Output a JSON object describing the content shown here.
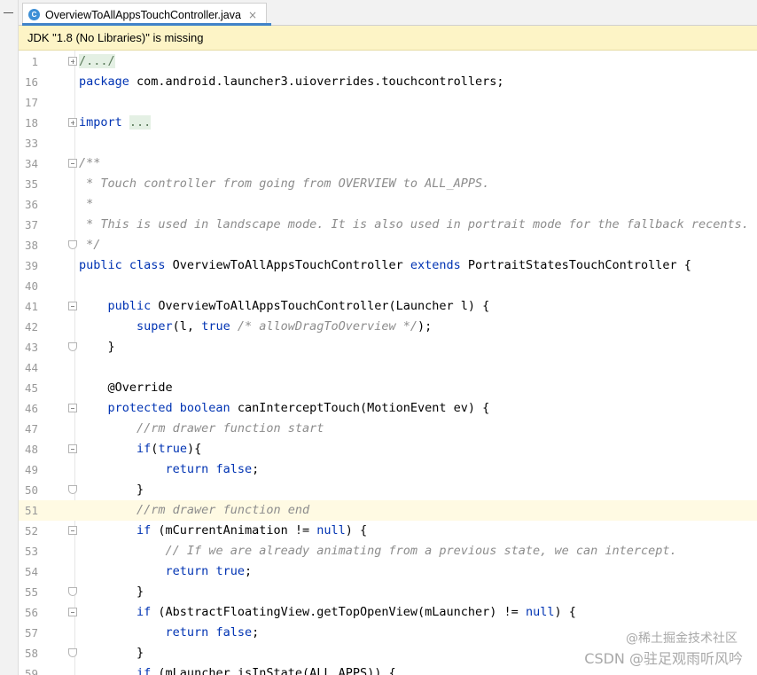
{
  "tab": {
    "icon_letter": "C",
    "file_name": "OverviewToAllAppsTouchController.java",
    "close_symbol": "×"
  },
  "notice": {
    "text": "JDK \"1.8 (No Libraries)\" is missing"
  },
  "editor": {
    "current_line": "51",
    "lines": [
      {
        "n": "1",
        "fold": "plus",
        "tokens": [
          {
            "t": "/.../",
            "c": "fold-text"
          }
        ]
      },
      {
        "n": "16",
        "fold": "",
        "tokens": [
          {
            "t": "package",
            "c": "kw"
          },
          {
            "t": " com.android.launcher3.uioverrides.touchcontrollers;",
            "c": ""
          }
        ]
      },
      {
        "n": "17",
        "fold": "",
        "tokens": []
      },
      {
        "n": "18",
        "fold": "plus",
        "tokens": [
          {
            "t": "import",
            "c": "kw"
          },
          {
            "t": " ",
            "c": ""
          },
          {
            "t": "...",
            "c": "fold-text"
          }
        ]
      },
      {
        "n": "33",
        "fold": "",
        "tokens": []
      },
      {
        "n": "34",
        "fold": "minus",
        "tokens": [
          {
            "t": "/**",
            "c": "cm"
          }
        ]
      },
      {
        "n": "35",
        "fold": "",
        "tokens": [
          {
            "t": " * Touch controller from going from OVERVIEW to ALL_APPS.",
            "c": "cm"
          }
        ]
      },
      {
        "n": "36",
        "fold": "",
        "tokens": [
          {
            "t": " *",
            "c": "cm"
          }
        ]
      },
      {
        "n": "37",
        "fold": "",
        "tokens": [
          {
            "t": " * This is used in landscape mode. It is also used in portrait mode for the fallback recents.",
            "c": "cm"
          }
        ]
      },
      {
        "n": "38",
        "fold": "end",
        "tokens": [
          {
            "t": " */",
            "c": "cm"
          }
        ]
      },
      {
        "n": "39",
        "fold": "",
        "tokens": [
          {
            "t": "public class",
            "c": "kw"
          },
          {
            "t": " OverviewToAllAppsTouchController ",
            "c": ""
          },
          {
            "t": "extends",
            "c": "kw"
          },
          {
            "t": " PortraitStatesTouchController {",
            "c": ""
          }
        ]
      },
      {
        "n": "40",
        "fold": "",
        "tokens": []
      },
      {
        "n": "41",
        "fold": "minus",
        "tokens": [
          {
            "t": "    ",
            "c": ""
          },
          {
            "t": "public",
            "c": "kw"
          },
          {
            "t": " OverviewToAllAppsTouchController(Launcher l) {",
            "c": ""
          }
        ]
      },
      {
        "n": "42",
        "fold": "",
        "tokens": [
          {
            "t": "        ",
            "c": ""
          },
          {
            "t": "super",
            "c": "kw"
          },
          {
            "t": "(l, ",
            "c": ""
          },
          {
            "t": "true",
            "c": "kw"
          },
          {
            "t": " ",
            "c": ""
          },
          {
            "t": "/* allowDragToOverview */",
            "c": "cm"
          },
          {
            "t": ");",
            "c": ""
          }
        ]
      },
      {
        "n": "43",
        "fold": "end",
        "tokens": [
          {
            "t": "    }",
            "c": ""
          }
        ]
      },
      {
        "n": "44",
        "fold": "",
        "tokens": []
      },
      {
        "n": "45",
        "fold": "",
        "tokens": [
          {
            "t": "    @Override",
            "c": "an"
          }
        ]
      },
      {
        "n": "46",
        "fold": "minus",
        "tokens": [
          {
            "t": "    ",
            "c": ""
          },
          {
            "t": "protected boolean",
            "c": "kw"
          },
          {
            "t": " canInterceptTouch(MotionEvent ev) {",
            "c": ""
          }
        ]
      },
      {
        "n": "47",
        "fold": "",
        "tokens": [
          {
            "t": "        ",
            "c": ""
          },
          {
            "t": "//rm drawer function start",
            "c": "cm"
          }
        ]
      },
      {
        "n": "48",
        "fold": "minus",
        "tokens": [
          {
            "t": "        ",
            "c": ""
          },
          {
            "t": "if",
            "c": "kw"
          },
          {
            "t": "(",
            "c": ""
          },
          {
            "t": "true",
            "c": "kw"
          },
          {
            "t": "){",
            "c": ""
          }
        ]
      },
      {
        "n": "49",
        "fold": "",
        "tokens": [
          {
            "t": "            ",
            "c": ""
          },
          {
            "t": "return false",
            "c": "kw"
          },
          {
            "t": ";",
            "c": ""
          }
        ]
      },
      {
        "n": "50",
        "fold": "end",
        "tokens": [
          {
            "t": "        }",
            "c": ""
          }
        ]
      },
      {
        "n": "51",
        "fold": "",
        "tokens": [
          {
            "t": "        ",
            "c": ""
          },
          {
            "t": "//rm drawer function end",
            "c": "cm"
          }
        ]
      },
      {
        "n": "52",
        "fold": "minus",
        "tokens": [
          {
            "t": "        ",
            "c": ""
          },
          {
            "t": "if",
            "c": "kw"
          },
          {
            "t": " (mCurrentAnimation != ",
            "c": ""
          },
          {
            "t": "null",
            "c": "kw"
          },
          {
            "t": ") {",
            "c": ""
          }
        ]
      },
      {
        "n": "53",
        "fold": "",
        "tokens": [
          {
            "t": "            ",
            "c": ""
          },
          {
            "t": "// If we are already animating from a previous state, we can intercept.",
            "c": "cm"
          }
        ]
      },
      {
        "n": "54",
        "fold": "",
        "tokens": [
          {
            "t": "            ",
            "c": ""
          },
          {
            "t": "return true",
            "c": "kw"
          },
          {
            "t": ";",
            "c": ""
          }
        ]
      },
      {
        "n": "55",
        "fold": "end",
        "tokens": [
          {
            "t": "        }",
            "c": ""
          }
        ]
      },
      {
        "n": "56",
        "fold": "minus",
        "tokens": [
          {
            "t": "        ",
            "c": ""
          },
          {
            "t": "if",
            "c": "kw"
          },
          {
            "t": " (AbstractFloatingView.getTopOpenView(mLauncher) != ",
            "c": ""
          },
          {
            "t": "null",
            "c": "kw"
          },
          {
            "t": ") {",
            "c": ""
          }
        ]
      },
      {
        "n": "57",
        "fold": "",
        "tokens": [
          {
            "t": "            ",
            "c": ""
          },
          {
            "t": "return false",
            "c": "kw"
          },
          {
            "t": ";",
            "c": ""
          }
        ]
      },
      {
        "n": "58",
        "fold": "end",
        "tokens": [
          {
            "t": "        }",
            "c": ""
          }
        ]
      },
      {
        "n": "59",
        "fold": "",
        "tokens": [
          {
            "t": "        ",
            "c": ""
          },
          {
            "t": "if",
            "c": "kw"
          },
          {
            "t": " (mLauncher.isInState(ALL_APPS)) {",
            "c": ""
          }
        ]
      }
    ]
  },
  "watermark": {
    "line1": "@稀土掘金技术社区",
    "line2": "CSDN @驻足观雨听风吟"
  },
  "colors": {
    "keyword": "#0033b3",
    "comment": "#8c8c8c",
    "notice_bg": "#fdf4c6",
    "current_line_bg": "#fffae3",
    "tab_accent": "#4083c9"
  }
}
